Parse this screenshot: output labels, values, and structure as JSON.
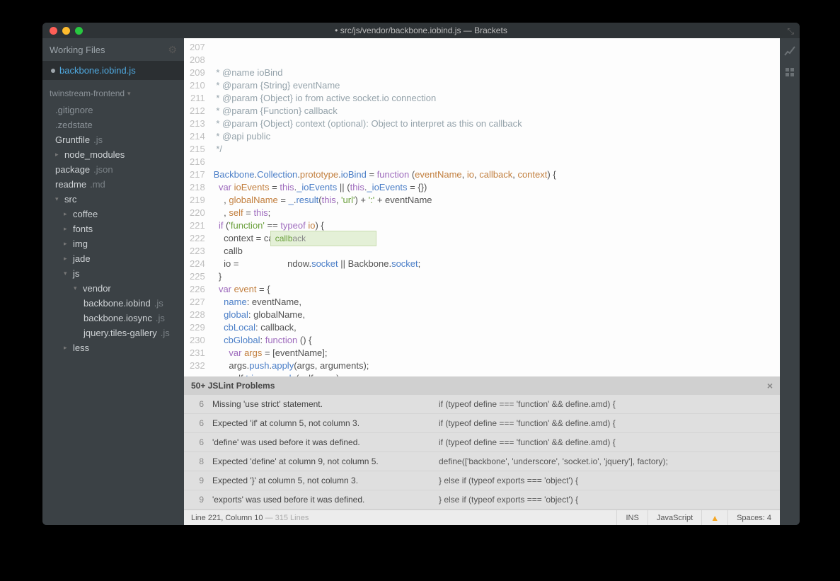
{
  "title": "• src/js/vendor/backbone.iobind.js — Brackets",
  "sidebar": {
    "workingFilesLabel": "Working Files",
    "workingFile": "backbone.iobind.js",
    "project": "twinstream-frontend",
    "tree": [
      {
        "name": ".gitignore",
        "ext": "",
        "indent": 0,
        "dim": true
      },
      {
        "name": ".zedstate",
        "ext": "",
        "indent": 0,
        "dim": true
      },
      {
        "name": "Gruntfile",
        "ext": ".js",
        "indent": 0
      },
      {
        "name": "node_modules",
        "ext": "",
        "indent": 0,
        "folder": true,
        "tri": "▸"
      },
      {
        "name": "package",
        "ext": ".json",
        "indent": 0
      },
      {
        "name": "readme",
        "ext": ".md",
        "indent": 0
      },
      {
        "name": "src",
        "ext": "",
        "indent": 0,
        "folder": true,
        "tri": "▾"
      },
      {
        "name": "coffee",
        "ext": "",
        "indent": 1,
        "folder": true,
        "tri": "▸"
      },
      {
        "name": "fonts",
        "ext": "",
        "indent": 1,
        "folder": true,
        "tri": "▸"
      },
      {
        "name": "img",
        "ext": "",
        "indent": 1,
        "folder": true,
        "tri": "▸"
      },
      {
        "name": "jade",
        "ext": "",
        "indent": 1,
        "folder": true,
        "tri": "▸"
      },
      {
        "name": "js",
        "ext": "",
        "indent": 1,
        "folder": true,
        "tri": "▾"
      },
      {
        "name": "vendor",
        "ext": "",
        "indent": 2,
        "folder": true,
        "tri": "▾"
      },
      {
        "name": "backbone.iobind",
        "ext": ".js",
        "indent": 3
      },
      {
        "name": "backbone.iosync",
        "ext": ".js",
        "indent": 3
      },
      {
        "name": "jquery.tiles-gallery",
        "ext": ".js",
        "indent": 3
      },
      {
        "name": "less",
        "ext": "",
        "indent": 1,
        "folder": true,
        "tri": "▸"
      }
    ]
  },
  "editor": {
    "startLine": 207,
    "lines": [
      {
        "n": 207,
        "html": " <span class='c-comment'>* @name ioBind</span>"
      },
      {
        "n": 208,
        "html": " <span class='c-comment'>* @param {String} eventName</span>"
      },
      {
        "n": 209,
        "html": " <span class='c-comment'>* @param {Object} io from active socket.io connection</span>"
      },
      {
        "n": 210,
        "html": " <span class='c-comment'>* @param {Function} callback</span>"
      },
      {
        "n": 211,
        "html": " <span class='c-comment'>* @param {Object} context (optional): Object to interpret as this on callback</span>"
      },
      {
        "n": 212,
        "html": " <span class='c-comment'>* @api public</span>"
      },
      {
        "n": 213,
        "html": " <span class='c-comment'>*/</span>"
      },
      {
        "n": 214,
        "html": ""
      },
      {
        "n": 215,
        "html": "<span class='c-fn'>Backbone</span>.<span class='c-fn'>Collection</span>.<span class='c-prop'>prototype</span>.<span class='c-fn'>ioBind</span> = <span class='c-kw'>function</span> (<span class='c-prop'>eventName</span>, <span class='c-prop'>io</span>, <span class='c-prop'>callback</span>, <span class='c-prop'>context</span>) {"
      },
      {
        "n": 216,
        "html": "  <span class='c-kw'>var</span> <span class='c-prop'>ioEvents</span> = <span class='c-this'>this</span>.<span class='c-fn'>_ioEvents</span> || (<span class='c-this'>this</span>.<span class='c-fn'>_ioEvents</span> = {})"
      },
      {
        "n": 217,
        "html": "    , <span class='c-prop'>globalName</span> = <span class='c-fn'>_</span>.<span class='c-fn'>result</span>(<span class='c-this'>this</span>, <span class='c-str'>'url'</span>) + <span class='c-str'>':'</span> + eventName"
      },
      {
        "n": 218,
        "html": "    , <span class='c-prop'>self</span> = <span class='c-this'>this</span>;"
      },
      {
        "n": 219,
        "html": "  <span class='c-kw'>if</span> (<span class='c-str'>'function'</span> == <span class='c-kw'>typeof</span> <span class='c-prop'>io</span>) {"
      },
      {
        "n": 220,
        "html": "    context = callback;"
      },
      {
        "n": 221,
        "html": "    callb"
      },
      {
        "n": 222,
        "html": "    io =                   ndow.<span class='c-fn'>socket</span> || Backbone.<span class='c-fn'>socket</span>;"
      },
      {
        "n": 223,
        "html": "  }"
      },
      {
        "n": 224,
        "html": "  <span class='c-kw'>var</span> <span class='c-prop'>event</span> = {"
      },
      {
        "n": 225,
        "html": "    <span class='c-fn'>name</span>: eventName,"
      },
      {
        "n": 226,
        "html": "    <span class='c-fn'>global</span>: globalName,"
      },
      {
        "n": 227,
        "html": "    <span class='c-fn'>cbLocal</span>: callback,"
      },
      {
        "n": 228,
        "html": "    <span class='c-fn'>cbGlobal</span>: <span class='c-kw'>function</span> () {"
      },
      {
        "n": 229,
        "html": "      <span class='c-kw'>var</span> <span class='c-prop'>args</span> = [eventName];"
      },
      {
        "n": 230,
        "html": "      args.<span class='c-fn'>push</span>.<span class='c-fn'>apply</span>(args, arguments);"
      },
      {
        "n": 231,
        "html": "      self.<span class='c-fn'>trigger</span>.<span class='c-fn'>apply</span>(self, args);"
      },
      {
        "n": 232,
        "html": "    }"
      }
    ],
    "hint": {
      "match": "callb",
      "rest": "ack"
    }
  },
  "panel": {
    "title": "50+ JSLint Problems",
    "problems": [
      {
        "line": 6,
        "msg": "Missing 'use strict' statement.",
        "src": "if (typeof define === 'function' && define.amd) {"
      },
      {
        "line": 6,
        "msg": "Expected 'if' at column 5, not column 3.",
        "src": "if (typeof define === 'function' && define.amd) {"
      },
      {
        "line": 6,
        "msg": "'define' was used before it was defined.",
        "src": "if (typeof define === 'function' && define.amd) {"
      },
      {
        "line": 8,
        "msg": "Expected 'define' at column 9, not column 5.",
        "src": "define(['backbone', 'underscore', 'socket.io', 'jquery'], factory);"
      },
      {
        "line": 9,
        "msg": "Expected '}' at column 5, not column 3.",
        "src": "} else if (typeof exports === 'object') {"
      },
      {
        "line": 9,
        "msg": "'exports' was used before it was defined.",
        "src": "} else if (typeof exports === 'object') {"
      }
    ]
  },
  "status": {
    "cursor": "Line 221, Column 10",
    "total": " — 315 Lines",
    "ins": "INS",
    "lang": "JavaScript",
    "spaces": "Spaces:  4"
  }
}
